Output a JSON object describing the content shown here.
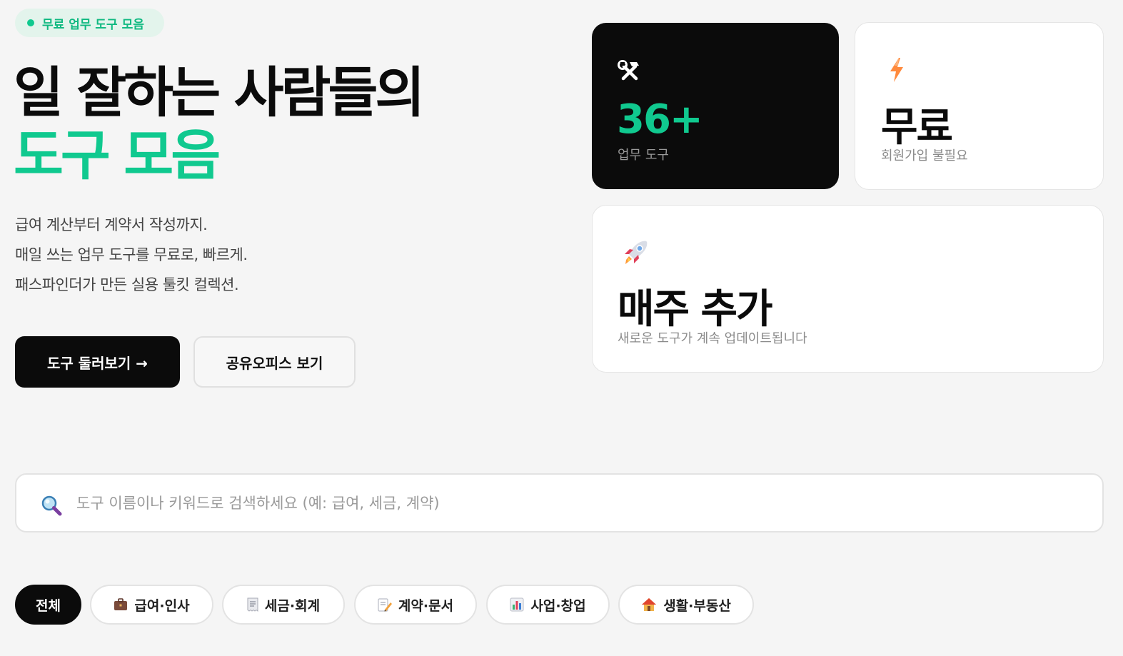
{
  "badge": {
    "label": "무료 업무 도구 모음"
  },
  "hero": {
    "title_line1": "일 잘하는 사람들의",
    "title_line2": "도구 모음",
    "description": [
      "급여 계산부터 계약서 작성까지.",
      "매일 쓰는 업무 도구를 무료로, 빠르게.",
      "패스파인더가 만든 실용 툴킷 컬렉션."
    ],
    "primary_button": "도구 둘러보기 →",
    "secondary_button": "공유오피스 보기"
  },
  "stats": {
    "tools": {
      "icon": "hammer-wrench-icon",
      "value": "36+",
      "label": "업무 도구"
    },
    "free": {
      "icon": "lightning-icon",
      "value": "무료",
      "label": "회원가입 불필요"
    },
    "weekly": {
      "icon": "rocket-icon",
      "value": "매주 추가",
      "label": "새로운 도구가 계속 업데이트됩니다"
    }
  },
  "search": {
    "icon": "magnifier-icon",
    "placeholder": "도구 이름이나 키워드로 검색하세요 (예: 급여, 세금, 계약)",
    "value": ""
  },
  "categories": [
    {
      "label": "전체",
      "icon": "",
      "active": true
    },
    {
      "label": "급여·인사",
      "icon": "briefcase-icon",
      "active": false
    },
    {
      "label": "세금·회계",
      "icon": "receipt-icon",
      "active": false
    },
    {
      "label": "계약·문서",
      "icon": "memo-icon",
      "active": false
    },
    {
      "label": "사업·창업",
      "icon": "bar-chart-icon",
      "active": false
    },
    {
      "label": "생활·부동산",
      "icon": "house-icon",
      "active": false
    }
  ],
  "colors": {
    "accent": "#10c98f",
    "badge_bg": "#e3f4ec",
    "dark": "#0b0b0b",
    "background": "#f5f5f5"
  }
}
